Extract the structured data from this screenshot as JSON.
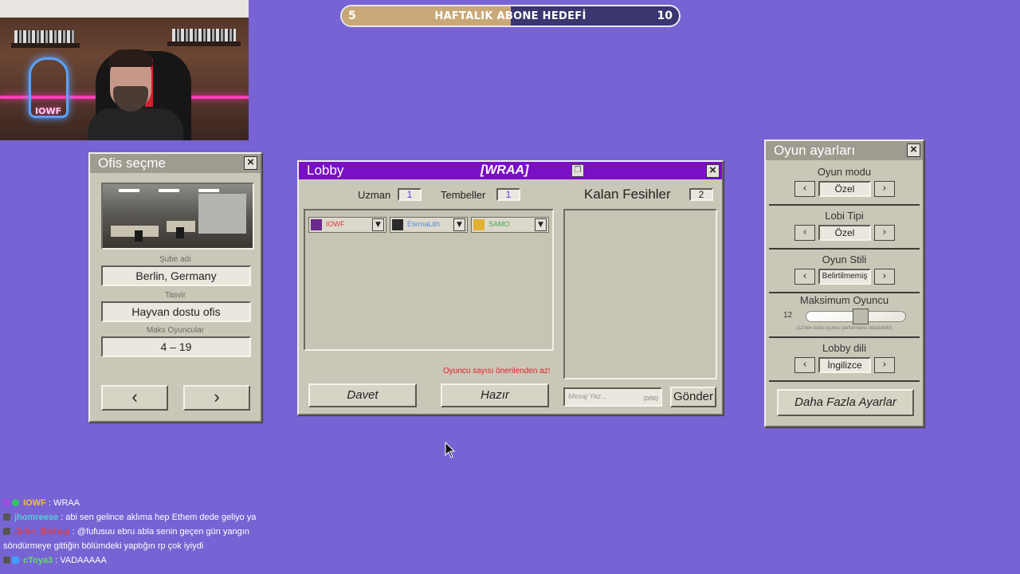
{
  "goal": {
    "title": "HAFTALIK ABONE HEDEFİ",
    "current": "5",
    "target": "10",
    "progress_fraction": 0.5
  },
  "webcam": {
    "neon_text": "IOWF"
  },
  "ofis": {
    "title": "Ofis seçme",
    "branch_label": "Şube adı",
    "branch_value": "Berlin, Germany",
    "desc_label": "Tasvir",
    "desc_value": "Hayvan dostu ofis",
    "max_label": "Maks Oyuncular",
    "max_value": "4 – 19",
    "prev_icon": "‹",
    "next_icon": "›"
  },
  "lobby": {
    "title": "Lobby",
    "code": "[WRAA]",
    "uzman_label": "Uzman",
    "uzman_value": "1",
    "tembel_label": "Tembeller",
    "tembel_value": "1",
    "kalan_label": "Kalan Fesihler",
    "kalan_value": "2",
    "players": [
      {
        "name": "IOWF",
        "color": "#d83a3a"
      },
      {
        "name": "EternaLith",
        "color": "#5a8ad8"
      },
      {
        "name": "SAMO",
        "color": "#4aa84a"
      }
    ],
    "warning": "Oyuncu sayısı önerilenden az!",
    "invite_label": "Davet",
    "ready_label": "Hazır",
    "message_placeholder": "Mesaj Yaz...",
    "message_count": "(0/50)",
    "send_label": "Gönder"
  },
  "settings": {
    "title": "Oyun ayarları",
    "mode_label": "Oyun modu",
    "mode_value": "Özel",
    "lobby_type_label": "Lobi Tipi",
    "lobby_type_value": "Özel",
    "style_label": "Oyun Stili",
    "style_value": "Belirtilmemiş",
    "max_players_label": "Maksimum Oyuncu",
    "max_players_value": "12",
    "max_players_slider_fraction": 0.55,
    "max_players_hint": "(12'den fazla oyuncu performansı düşürebilir)",
    "lang_label": "Lobby dili",
    "lang_value": "İngilizce",
    "more_label": "Daha Fazla Ayarlar"
  },
  "chat": [
    {
      "user": "IOWF",
      "color": "#f0c040",
      "text": ": WRAA"
    },
    {
      "user": "jhomreese",
      "color": "#4fd1d8",
      "text": ": abi sen gelince aklıma hep Ethem dede geliyo ya"
    },
    {
      "user": "John_Bishop",
      "color": "#e04040",
      "text": ": @fufusuu ebru abla senin geçen gün yangın söndürmeye gittiğin bölümdeki yaptığın rp çok iyiydi"
    },
    {
      "user": "cToya3",
      "color": "#60e060",
      "text": ": VADAAAAA"
    }
  ]
}
